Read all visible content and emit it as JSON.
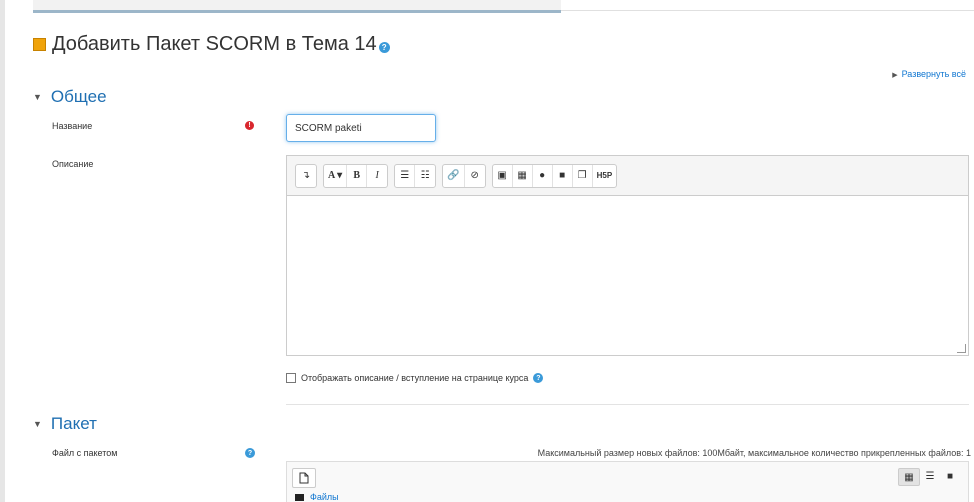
{
  "page": {
    "title": "Добавить Пакет SCORM в Тема 14",
    "expand_all": "Развернуть всё"
  },
  "general": {
    "header": "Общее",
    "name_label": "Название",
    "name_value": "SCORM paketi",
    "description_label": "Описание",
    "show_description": "Отображать описание / вступление на странице курса"
  },
  "editor": {
    "toolbar": [
      {
        "icon": "collapse-icon",
        "glyph": "↴"
      },
      {
        "icon": "font-size-icon",
        "glyph": "A ▾"
      },
      {
        "icon": "bold-icon",
        "glyph": "B"
      },
      {
        "icon": "italic-icon",
        "glyph": "I"
      },
      {
        "icon": "bullet-list-icon",
        "glyph": "☰"
      },
      {
        "icon": "numbered-list-icon",
        "glyph": "☷"
      },
      {
        "icon": "link-icon",
        "glyph": "🔗"
      },
      {
        "icon": "unlink-icon",
        "glyph": "⊘"
      },
      {
        "icon": "image-icon",
        "glyph": "▣"
      },
      {
        "icon": "media-icon",
        "glyph": "▦"
      },
      {
        "icon": "record-audio-icon",
        "glyph": "●"
      },
      {
        "icon": "record-video-icon",
        "glyph": "■"
      },
      {
        "icon": "manage-files-icon",
        "glyph": "❐"
      },
      {
        "icon": "h5p-icon",
        "glyph": "H5P"
      }
    ]
  },
  "package": {
    "header": "Пакет",
    "file_label": "Файл с пакетом",
    "limits_text": "Максимальный размер новых файлов: 100Мбайт, максимальное количество прикрепленных файлов: 1",
    "folder_label": "Файлы"
  },
  "colors": {
    "link": "#1177d1",
    "section_header": "#1f6fb2",
    "required": "#d9272e",
    "help": "#3a9ad9",
    "title_icon": "#f0a30a"
  }
}
